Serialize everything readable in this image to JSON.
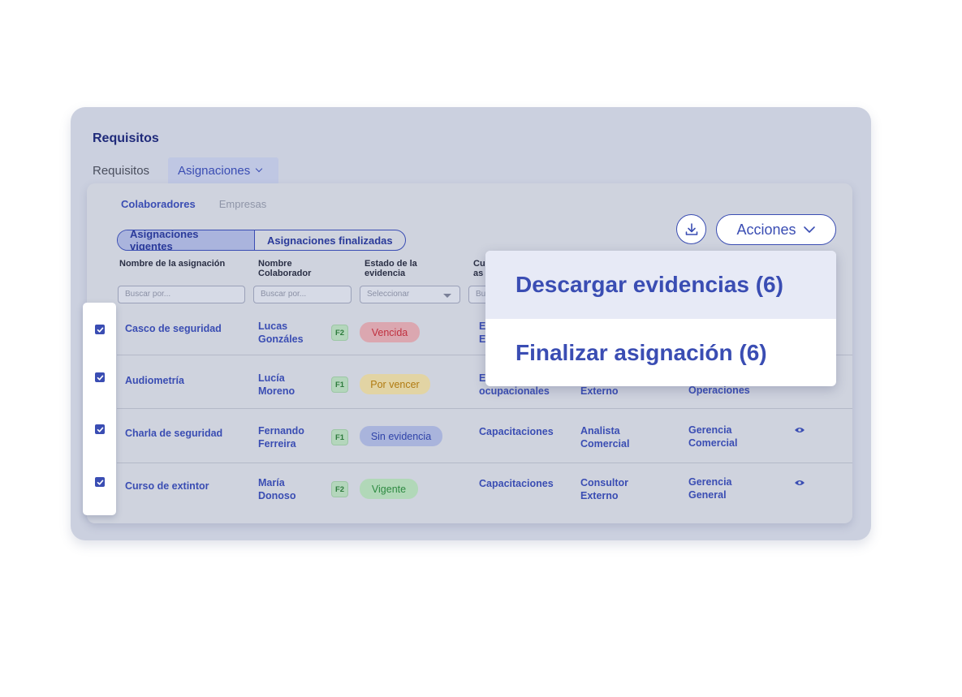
{
  "header": {
    "title": "Requisitos",
    "tabs": [
      {
        "label": "Requisitos"
      },
      {
        "label": "Asignaciones"
      }
    ]
  },
  "sub_tabs": [
    {
      "label": "Colaboradores"
    },
    {
      "label": "Empresas"
    }
  ],
  "segmented": [
    {
      "label": "Asignaciones vigentes"
    },
    {
      "label": "Asignaciones finalizadas"
    }
  ],
  "actions": {
    "label": "Acciones"
  },
  "columns": {
    "nombre_asignacion": "Nombre de la asignación",
    "nombre_colaborador": "Nombre\nColaborador",
    "estado": "Estado de la\nevidencia",
    "cu_partial": "Cu\nas"
  },
  "filters": {
    "buscar_placeholder": "Buscar por...",
    "seleccionar": "Seleccionar",
    "bu_partial": "Bu"
  },
  "rows": [
    {
      "name": "Casco de seguridad",
      "person": "Lucas\nGonzáles",
      "f": "F2",
      "status": "Vencida",
      "category": "E\nE",
      "role": "",
      "area": "",
      "eye": false
    },
    {
      "name": "Audiometría",
      "person": "Lucía\nMoreno",
      "f": "F1",
      "status": "Por vencer",
      "category": "E\nocupacionales",
      "role": "Externo",
      "area": "Operaciones",
      "eye": false
    },
    {
      "name": "Charla de seguridad",
      "person": "Fernando\nFerreira",
      "f": "F1",
      "status": "Sin evidencia",
      "category": "Capacitaciones",
      "role": "Analista\nComercial",
      "area": "Gerencia\nComercial",
      "eye": true
    },
    {
      "name": "Curso de extintor",
      "person": "María\nDonoso",
      "f": "F2",
      "status": "Vigente",
      "category": "Capacitaciones",
      "role": "Consultor\nExterno",
      "area": "Gerencia\nGeneral",
      "eye": true
    }
  ],
  "dropdown": [
    {
      "label": "Descargar evidencias (6)"
    },
    {
      "label": "Finalizar asignación (6)"
    }
  ],
  "colors": {
    "accent": "#3a4db3",
    "vencida_bg": "#dba7b0",
    "vencida_fg": "#c0303f",
    "por_vencer_bg": "#e2d4a4",
    "por_vencer_fg": "#b07a10",
    "sin_evidencia_bg": "#a9b4dc",
    "sin_evidencia_fg": "#2f43a8",
    "vigente_bg": "#b1d8b8",
    "vigente_fg": "#2e8a42"
  }
}
